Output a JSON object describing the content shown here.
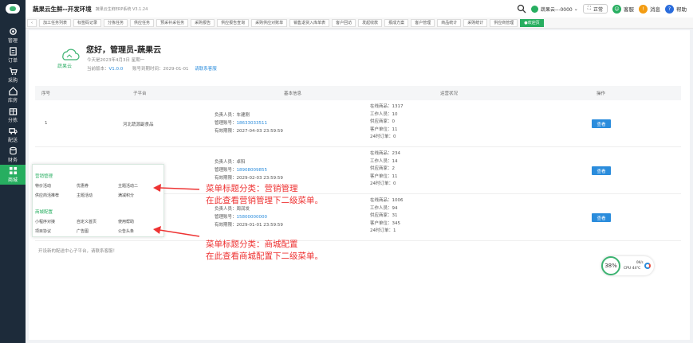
{
  "app": {
    "title": "蔬果云生鲜--开发环境",
    "subtitle": "蔬果云生鲜ERP系统  V3.1.24"
  },
  "topbar": {
    "user": "蔬果云---0000",
    "std_label": "正常",
    "service_label": "客服",
    "msg_label": "消息",
    "help_label": "帮助"
  },
  "sidebar": {
    "items": [
      {
        "label": "管理",
        "icon": "gear-icon"
      },
      {
        "label": "订单",
        "icon": "document-icon"
      },
      {
        "label": "采购",
        "icon": "cart-icon"
      },
      {
        "label": "库房",
        "icon": "home-icon"
      },
      {
        "label": "分拣",
        "icon": "box-icon"
      },
      {
        "label": "配送",
        "icon": "truck-icon"
      },
      {
        "label": "财务",
        "icon": "database-icon"
      },
      {
        "label": "商城",
        "icon": "grid-icon"
      }
    ]
  },
  "tabs": [
    "加工任务列表",
    "标签码记录",
    "分拣任务",
    "供应任务",
    "预采补采任务",
    "采购报告",
    "供应报告查询",
    "采购供应对账单",
    "销售退货入库单表",
    "客户回访",
    "发起收款",
    "报成方案",
    "客户管理",
    "商品统计",
    "采购统计",
    "供应商管理",
    "●欢迎页"
  ],
  "welcome": {
    "logo_text": "蔬果云",
    "greeting": "您好，管理员-蔬果云",
    "date": "今天是2023年4月3日 星期一",
    "version_label": "当前版本：",
    "version": "V1.0.0",
    "expire": "账号到期时间：2029-01-01",
    "contact": "请联系客服"
  },
  "table": {
    "headers": [
      "序号",
      "子平台",
      "基本信息",
      "运营状况",
      "操作"
    ],
    "rows": [
      {
        "no": "1",
        "platform": "河北蔬源副食品",
        "owner": "负责人员：车建刚",
        "phone_label": "管理账号：",
        "phone": "18633033511",
        "expire_label": "有效期限：",
        "expire": "2027-04-03 23:59:59",
        "stats": [
          "在线商品：1317",
          "工作人员：10",
          "供应商家：0",
          "客户单位：11",
          "24时订单：0"
        ],
        "btn": "查看"
      },
      {
        "no": "",
        "platform": "",
        "owner": "负责人员：卓阳",
        "phone_label": "管理账号：",
        "phone": "18908009855",
        "expire_label": "有效期限：",
        "expire": "2029-02-03 23:59:59",
        "stats": [
          "在线商品：234",
          "工作人员：14",
          "供应商家：2",
          "客户单位：11",
          "24时订单：0"
        ],
        "btn": "查看"
      },
      {
        "no": "",
        "platform": "",
        "owner": "负责人员：周润发",
        "phone_label": "管理账号：",
        "phone": "15800000000",
        "expire_label": "有效期限：",
        "expire": "2029-01-01 23:59:59",
        "stats": [
          "在线商品：1006",
          "工作人员：94",
          "供应商家：31",
          "客户单位：345",
          "24时订单：1"
        ],
        "btn": "查看"
      }
    ]
  },
  "tip": "开设新的配送中心子平台，请联系客服！",
  "popup": {
    "cat1": "营销管理",
    "cat1_items": [
      "特价活动",
      "优惠券",
      "主题活动二",
      "供应商活推荐",
      "主题活动",
      "满减积分"
    ],
    "cat2": "商城配置",
    "cat2_items": [
      "小程序对接",
      "自定义首页",
      "使用帮助",
      "项目协议",
      "广告图",
      "公告头条"
    ]
  },
  "annotations": {
    "a1_l1": "菜单标题分类：营销管理",
    "a1_l2": "在此查看营销管理下二级菜单。",
    "a2_l1": "菜单标题分类：商城配置",
    "a2_l2": "在此查看商城配置下二级菜单。"
  },
  "cpu_widget": {
    "percent": "38%",
    "cpu": "CPU 44℃",
    "kb": "0K/s"
  },
  "colors": {
    "brand": "#27ae60",
    "link": "#2a8cdc",
    "annotation": "#ee3333"
  }
}
